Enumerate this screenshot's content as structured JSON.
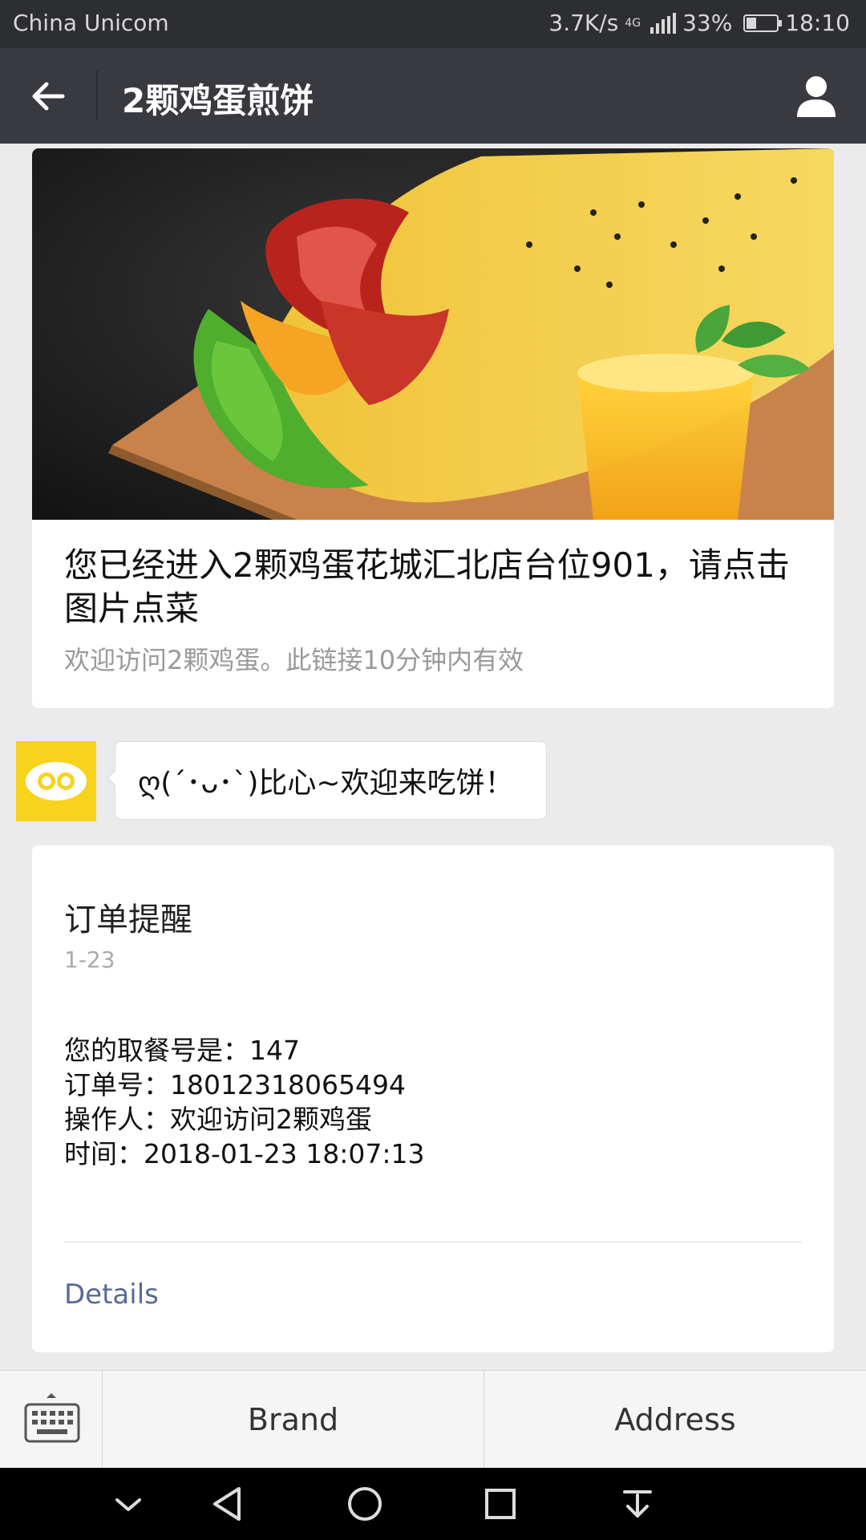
{
  "status_bar": {
    "carrier": "China Unicom",
    "speed": "3.7K/s",
    "network": "4G",
    "battery": "33%",
    "battery_level": 0.33,
    "time": "18:10"
  },
  "header": {
    "title": "2颗鸡蛋煎饼",
    "back_icon": "arrow-left-icon",
    "profile_icon": "person-icon"
  },
  "article": {
    "title": "您已经进入2颗鸡蛋花城汇北店台位901，请点击图片点菜",
    "description": "欢迎访问2颗鸡蛋。此链接10分钟内有效"
  },
  "chat": {
    "message": "ღ(´･ᴗ･`)比心~欢迎来吃饼！"
  },
  "order": {
    "title": "订单提醒",
    "date": "1-23",
    "lines": [
      "您的取餐号是：147",
      "订单号：18012318065494",
      "操作人：欢迎访问2颗鸡蛋",
      "时间：2018-01-23 18:07:13"
    ],
    "details_label": "Details"
  },
  "bottom_menu": {
    "keyboard_icon": "keyboard-icon",
    "items": [
      "Brand",
      "Address"
    ]
  },
  "colors": {
    "header_bg": "#393a3f",
    "status_bg": "#2d2e31",
    "page_bg": "#ebebeb",
    "link": "#576b95",
    "brand_yellow": "#f7d31e"
  }
}
